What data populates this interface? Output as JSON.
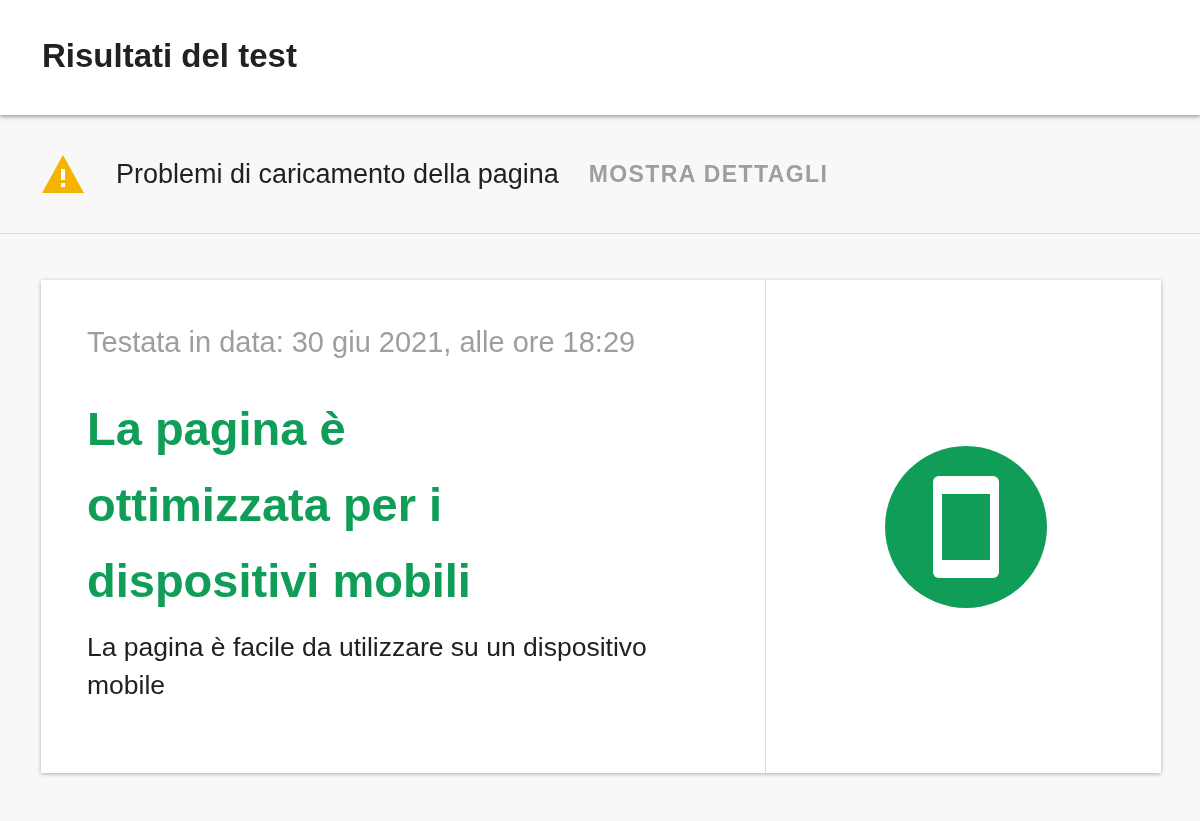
{
  "header": {
    "title": "Risultati del test"
  },
  "warning_bar": {
    "kind": "warning",
    "message": "Problemi di caricamento della pagina",
    "action": "MOSTRA DETTAGLI"
  },
  "result_card": {
    "tested_on": "Testata in data: 30 giu 2021, alle ore 18:29",
    "kind": "pass",
    "verdict": "La pagina è ottimizzata per i dispositivi mobili",
    "description": "La pagina è facile da utilizzare su un dispositivo mobile"
  }
}
